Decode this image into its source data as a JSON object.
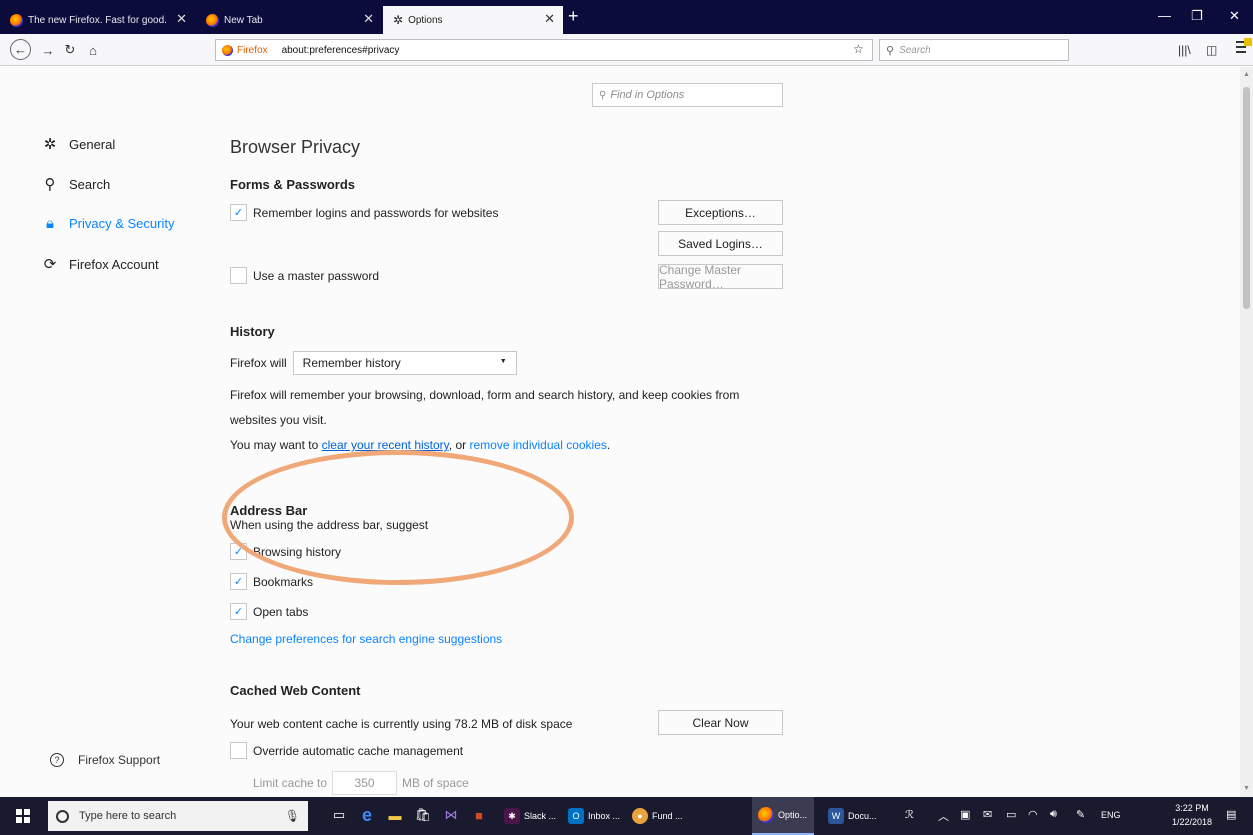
{
  "tabs": [
    {
      "title": "The new Firefox. Fast for good.",
      "active": false
    },
    {
      "title": "New Tab",
      "active": false
    },
    {
      "title": "Options",
      "active": true
    }
  ],
  "navbar": {
    "identity_label": "Firefox",
    "url": "about:preferences#privacy",
    "search_placeholder": "Search"
  },
  "find": {
    "placeholder": "Find in Options"
  },
  "sidebar": {
    "items": [
      {
        "label": "General",
        "icon": "gear-icon",
        "selected": false
      },
      {
        "label": "Search",
        "icon": "search-icon",
        "selected": false
      },
      {
        "label": "Privacy & Security",
        "icon": "lock-icon",
        "selected": true
      },
      {
        "label": "Firefox Account",
        "icon": "sync-icon",
        "selected": false
      }
    ],
    "support_label": "Firefox Support"
  },
  "page": {
    "title": "Browser Privacy",
    "forms": {
      "heading": "Forms & Passwords",
      "remember_logins": {
        "label": "Remember logins and passwords for websites",
        "checked": true
      },
      "master_password": {
        "label": "Use a master password",
        "checked": false
      },
      "exceptions_button": "Exceptions…",
      "saved_logins_button": "Saved Logins…",
      "change_master_button": "Change Master Password…"
    },
    "history": {
      "heading": "History",
      "firefox_will_label": "Firefox will",
      "mode_selected": "Remember history",
      "description_line1": "Firefox will remember your browsing, download, form and search history, and keep cookies from",
      "description_line2": "websites you visit.",
      "hint_prefix": "You may want to",
      "clear_link": "clear your recent history",
      "hint_middle": ", or",
      "remove_cookies_link": "remove individual cookies",
      "hint_suffix": "."
    },
    "address_bar": {
      "heading": "Address Bar",
      "suggest_label": "When using the address bar, suggest",
      "options": [
        {
          "label": "Browsing history",
          "checked": true
        },
        {
          "label": "Bookmarks",
          "checked": true
        },
        {
          "label": "Open tabs",
          "checked": true
        }
      ],
      "change_prefs_link": "Change preferences for search engine suggestions"
    },
    "cache": {
      "heading": "Cached Web Content",
      "usage_text": "Your web content cache is currently using 78.2 MB of disk space",
      "clear_now_button": "Clear Now",
      "override": {
        "label": "Override automatic cache management",
        "checked": false
      },
      "limit_label": "Limit cache to",
      "limit_value": "350",
      "limit_unit": "MB of space"
    }
  },
  "taskbar": {
    "search_placeholder": "Type here to search",
    "apps": [
      {
        "label": "Slack ..."
      },
      {
        "label": "Inbox ..."
      },
      {
        "label": "Fund ..."
      },
      {
        "label": "Optio..."
      },
      {
        "label": "Docu..."
      }
    ],
    "language": "ENG",
    "time": "3:22 PM",
    "date": "1/22/2018"
  },
  "colors": {
    "accent": "#0a84ff",
    "tabstrip": "#0c0c3c",
    "annotation_ellipse": "#f0a878"
  }
}
